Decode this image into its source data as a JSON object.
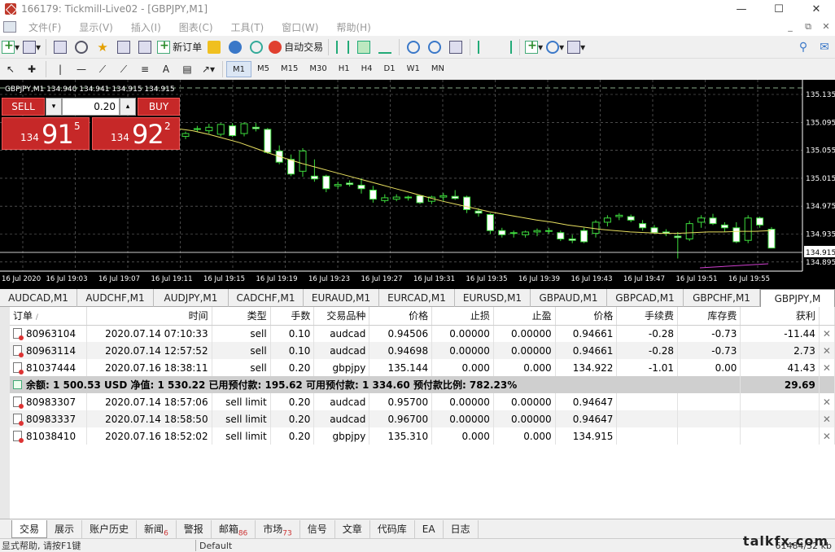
{
  "window": {
    "title": "166179: Tickmill-Live02 - [GBPJPY,M1]"
  },
  "menu": [
    "文件(F)",
    "显示(V)",
    "插入(I)",
    "图表(C)",
    "工具(T)",
    "窗口(W)",
    "帮助(H)"
  ],
  "toolbar": {
    "new_order": "新订单",
    "auto_trade": "自动交易"
  },
  "timeframes": [
    "M1",
    "M5",
    "M15",
    "M30",
    "H1",
    "H4",
    "D1",
    "W1",
    "MN"
  ],
  "active_timeframe": "M1",
  "chart": {
    "header": "GBPJPY,M1  134.940 134.941 134.915 134.915",
    "last_price": "134.915",
    "price_labels": [
      "135.135",
      "135.095",
      "135.055",
      "135.015",
      "134.975",
      "134.935",
      "134.895"
    ],
    "time_labels": [
      "16 Jul 2020",
      "16 Jul 19:03",
      "16 Jul 19:07",
      "16 Jul 19:11",
      "16 Jul 19:15",
      "16 Jul 19:19",
      "16 Jul 19:23",
      "16 Jul 19:27",
      "16 Jul 19:31",
      "16 Jul 19:35",
      "16 Jul 19:39",
      "16 Jul 19:43",
      "16 Jul 19:47",
      "16 Jul 19:51",
      "16 Jul 19:55"
    ]
  },
  "trade_panel": {
    "sell_label": "SELL",
    "buy_label": "BUY",
    "lot": "0.20",
    "sell_small": "134",
    "sell_big": "91",
    "sell_sup": "5",
    "buy_small": "134",
    "buy_big": "92",
    "buy_sup": "2"
  },
  "symbol_tabs": [
    "AUDCAD,M1",
    "AUDCHF,M1",
    "AUDJPY,M1",
    "CADCHF,M1",
    "EURAUD,M1",
    "EURCAD,M1",
    "EURUSD,M1",
    "GBPAUD,M1",
    "GBPCAD,M1",
    "GBPCHF,M1",
    "GBPJPY,M"
  ],
  "active_symbol_tab": "GBPJPY,M",
  "terminal": {
    "columns": [
      "订单",
      "/",
      "时间",
      "类型",
      "手数",
      "交易品种",
      "价格",
      "止损",
      "止盈",
      "价格",
      "手续费",
      "库存费",
      "获利"
    ],
    "orders": [
      [
        "80963104",
        "2020.07.14 07:10:33",
        "sell",
        "0.10",
        "audcad",
        "0.94506",
        "0.00000",
        "0.00000",
        "0.94661",
        "-0.28",
        "-0.73",
        "-11.44"
      ],
      [
        "80963114",
        "2020.07.14 12:57:52",
        "sell",
        "0.10",
        "audcad",
        "0.94698",
        "0.00000",
        "0.00000",
        "0.94661",
        "-0.28",
        "-0.73",
        "2.73"
      ],
      [
        "81037444",
        "2020.07.16 18:38:11",
        "sell",
        "0.20",
        "gbpjpy",
        "135.144",
        "0.000",
        "0.000",
        "134.922",
        "-1.01",
        "0.00",
        "41.43"
      ]
    ],
    "summary": "余额: 1 500.53 USD  净值: 1 530.22  已用预付款: 195.62  可用预付款: 1 334.60  预付款比例: 782.23%",
    "summary_profit": "29.69",
    "pending": [
      [
        "80983307",
        "2020.07.14 18:57:06",
        "sell limit",
        "0.20",
        "audcad",
        "0.95700",
        "0.00000",
        "0.00000",
        "0.94647"
      ],
      [
        "80983337",
        "2020.07.14 18:58:50",
        "sell limit",
        "0.20",
        "audcad",
        "0.96700",
        "0.00000",
        "0.00000",
        "0.94647"
      ],
      [
        "81038410",
        "2020.07.16 18:52:02",
        "sell limit",
        "0.20",
        "gbpjpy",
        "135.310",
        "0.000",
        "0.000",
        "134.915"
      ]
    ]
  },
  "bottom_tabs": [
    {
      "label": "交易",
      "badge": ""
    },
    {
      "label": "展示",
      "badge": ""
    },
    {
      "label": "账户历史",
      "badge": ""
    },
    {
      "label": "新闻",
      "badge": "6"
    },
    {
      "label": "警报",
      "badge": ""
    },
    {
      "label": "邮箱",
      "badge": "86"
    },
    {
      "label": "市场",
      "badge": "73"
    },
    {
      "label": "信号",
      "badge": ""
    },
    {
      "label": "文章",
      "badge": ""
    },
    {
      "label": "代码库",
      "badge": ""
    },
    {
      "label": "EA",
      "badge": ""
    },
    {
      "label": "日志",
      "badge": ""
    }
  ],
  "status": {
    "help": "显式帮助, 请按F1键",
    "profile": "Default",
    "traffic": "61484/32 kb"
  },
  "watermark": "talkfx.com"
}
